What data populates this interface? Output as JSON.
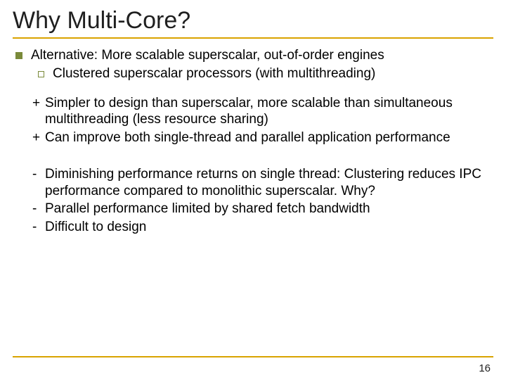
{
  "title": "Why Multi-Core?",
  "bullet_main": "Alternative: More scalable superscalar, out-of-order engines",
  "bullet_sub": "Clustered superscalar processors (with multithreading)",
  "plus": [
    "Simpler to design than superscalar, more scalable than simultaneous multithreading (less resource sharing)",
    "Can improve both single-thread and parallel application performance"
  ],
  "minus": [
    "Diminishing performance returns on single thread: Clustering reduces IPC performance compared to monolithic superscalar. Why?",
    "Parallel performance limited by shared fetch bandwidth",
    "Difficult to design"
  ],
  "pagenum": "16"
}
